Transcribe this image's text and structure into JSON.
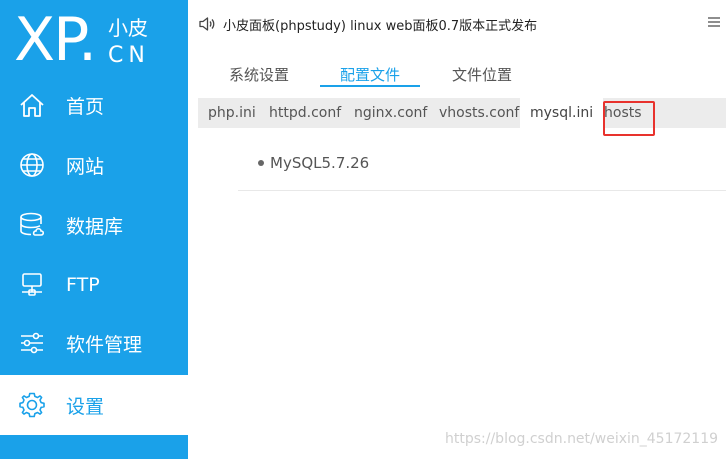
{
  "logo": {
    "main": "XP.",
    "sub_top": "小皮",
    "sub_bottom": "CN"
  },
  "sidebar": {
    "items": [
      {
        "label": "首页",
        "icon": "home-icon"
      },
      {
        "label": "网站",
        "icon": "globe-icon"
      },
      {
        "label": "数据库",
        "icon": "database-icon"
      },
      {
        "label": "FTP",
        "icon": "server-icon"
      },
      {
        "label": "软件管理",
        "icon": "sliders-icon"
      },
      {
        "label": "设置",
        "icon": "gear-icon",
        "active": true
      }
    ]
  },
  "topbar": {
    "announcement": "小皮面板(phpstudy) linux web面板0.7版本正式发布",
    "speaker_icon": "speaker-icon",
    "menu_icon": "menu-icon"
  },
  "tabs": [
    {
      "label": "系统设置"
    },
    {
      "label": "配置文件",
      "active": true
    },
    {
      "label": "文件位置"
    }
  ],
  "subtabs": [
    {
      "label": "php.ini"
    },
    {
      "label": "httpd.conf"
    },
    {
      "label": "nginx.conf"
    },
    {
      "label": "vhosts.conf"
    },
    {
      "label": "mysql.ini",
      "active": true
    },
    {
      "label": "hosts",
      "highlighted": true
    }
  ],
  "content": {
    "items": [
      "MySQL5.7.26"
    ]
  },
  "watermark": "https://blog.csdn.net/weixin_45172119",
  "colors": {
    "accent": "#1aa1e9",
    "highlight": "#e8322d"
  }
}
